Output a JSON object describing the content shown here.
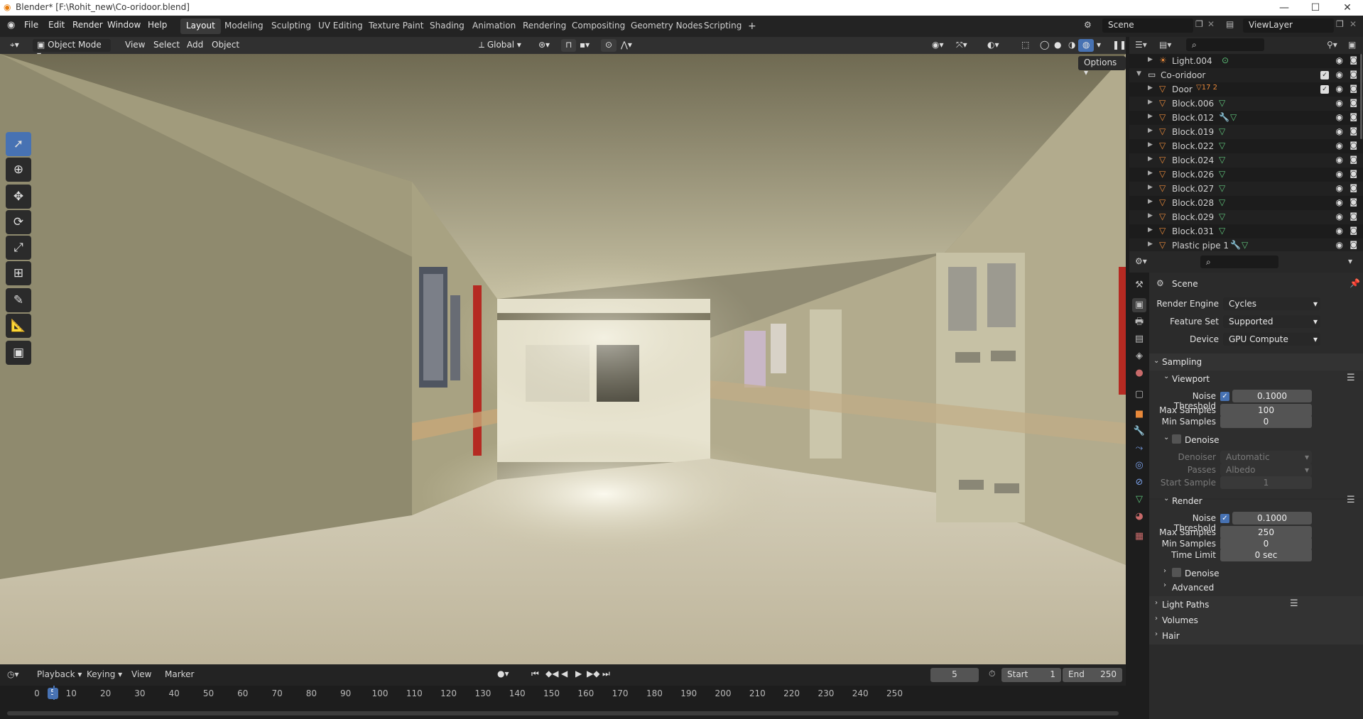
{
  "window": {
    "title": "Blender* [F:\\Rohit_new\\Co-oridoor.blend]",
    "minimize": "—",
    "maximize": "☐",
    "close": "✕"
  },
  "menu": [
    "File",
    "Edit",
    "Render",
    "Window",
    "Help"
  ],
  "workspaces": [
    "Layout",
    "Modeling",
    "Sculpting",
    "UV Editing",
    "Texture Paint",
    "Shading",
    "Animation",
    "Rendering",
    "Compositing",
    "Geometry Nodes",
    "Scripting"
  ],
  "active_workspace": "Layout",
  "add_workspace": "+",
  "scene_name": "Scene",
  "view_layer": "ViewLayer",
  "viewport_header": {
    "mode": "Object Mode",
    "menus": [
      "View",
      "Select",
      "Add",
      "Object"
    ],
    "orientation": "Global",
    "options": "Options"
  },
  "outliner": {
    "rows": [
      {
        "name": "Light.004",
        "indent": 1,
        "type": "light"
      },
      {
        "name": "Co-oridoor",
        "indent": 0,
        "type": "collection",
        "expanded": true
      },
      {
        "name": "Door",
        "indent": 1,
        "type": "object",
        "badge": "17",
        "badge2": "2"
      },
      {
        "name": "Block.006",
        "indent": 1,
        "type": "mesh"
      },
      {
        "name": "Block.012",
        "indent": 1,
        "type": "mesh",
        "wrench": true
      },
      {
        "name": "Block.019",
        "indent": 1,
        "type": "mesh"
      },
      {
        "name": "Block.022",
        "indent": 1,
        "type": "mesh"
      },
      {
        "name": "Block.024",
        "indent": 1,
        "type": "mesh"
      },
      {
        "name": "Block.026",
        "indent": 1,
        "type": "mesh"
      },
      {
        "name": "Block.027",
        "indent": 1,
        "type": "mesh"
      },
      {
        "name": "Block.028",
        "indent": 1,
        "type": "mesh"
      },
      {
        "name": "Block.029",
        "indent": 1,
        "type": "mesh"
      },
      {
        "name": "Block.031",
        "indent": 1,
        "type": "mesh"
      },
      {
        "name": "Plastic pipe 1",
        "indent": 1,
        "type": "mesh",
        "wrench": true
      }
    ]
  },
  "properties": {
    "context": "Scene",
    "render_engine_label": "Render Engine",
    "render_engine": "Cycles",
    "feature_set_label": "Feature Set",
    "feature_set": "Supported",
    "device_label": "Device",
    "device": "GPU Compute",
    "sampling": "Sampling",
    "viewport": {
      "title": "Viewport",
      "noise_threshold_label": "Noise Threshold",
      "noise_threshold": "0.1000",
      "max_samples_label": "Max Samples",
      "max_samples": "100",
      "min_samples_label": "Min Samples",
      "min_samples": "0",
      "denoise": "Denoise",
      "denoiser_label": "Denoiser",
      "denoiser": "Automatic",
      "passes_label": "Passes",
      "passes": "Albedo",
      "start_sample_label": "Start Sample",
      "start_sample": "1"
    },
    "render": {
      "title": "Render",
      "noise_threshold_label": "Noise Threshold",
      "noise_threshold": "0.1000",
      "max_samples_label": "Max Samples",
      "max_samples": "250",
      "min_samples_label": "Min Samples",
      "min_samples": "0",
      "time_limit_label": "Time Limit",
      "time_limit": "0 sec",
      "denoise": "Denoise"
    },
    "advanced": "Advanced",
    "light_paths": "Light Paths",
    "volumes": "Volumes",
    "hair": "Hair"
  },
  "timeline": {
    "menus": [
      "Playback",
      "Keying",
      "View",
      "Marker"
    ],
    "current_frame": "5",
    "start_label": "Start",
    "start": "1",
    "end_label": "End",
    "end": "250",
    "ticks": [
      "0",
      "10",
      "20",
      "30",
      "40",
      "50",
      "60",
      "70",
      "80",
      "90",
      "100",
      "110",
      "120",
      "130",
      "140",
      "150",
      "160",
      "170",
      "180",
      "190",
      "200",
      "210",
      "220",
      "230",
      "240",
      "250"
    ]
  },
  "colors": {
    "accent": "#4772b3",
    "mesh_icon": "#e8893a",
    "data_icon": "#5ec27a"
  }
}
